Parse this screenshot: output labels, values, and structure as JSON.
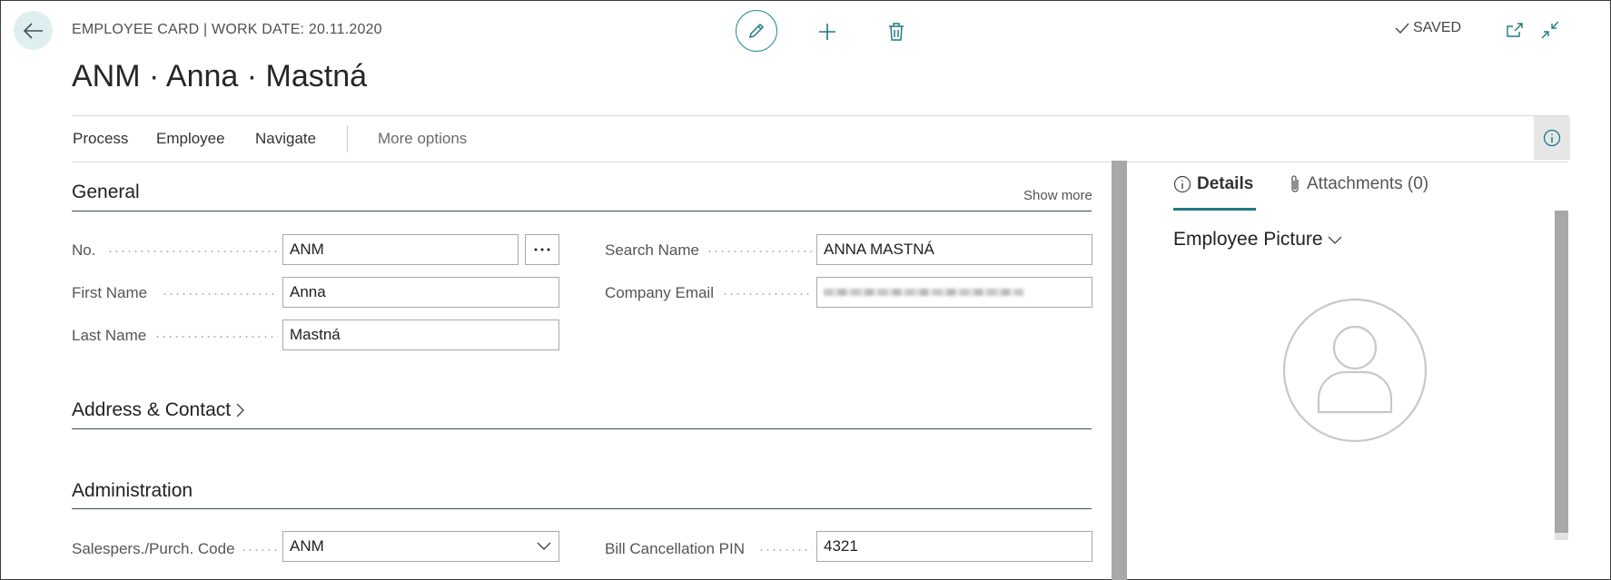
{
  "header": {
    "caption": "EMPLOYEE CARD | WORK DATE: 20.11.2020",
    "title": "ANM · Anna · Mastná",
    "saved_label": "SAVED"
  },
  "actions": [
    {
      "label": "Process"
    },
    {
      "label": "Employee"
    },
    {
      "label": "Navigate"
    },
    {
      "label": "More options"
    }
  ],
  "general": {
    "title": "General",
    "show_more": "Show more",
    "fields": {
      "no": {
        "label": "No.",
        "value": "ANM"
      },
      "first_name": {
        "label": "First Name",
        "value": "Anna"
      },
      "last_name": {
        "label": "Last Name",
        "value": "Mastná"
      },
      "search_name": {
        "label": "Search Name",
        "value": "ANNA MASTNÁ"
      },
      "company_email": {
        "label": "Company Email",
        "value": ""
      }
    }
  },
  "address_contact": {
    "title": "Address & Contact"
  },
  "administration": {
    "title": "Administration",
    "fields": {
      "salesperson": {
        "label": "Salespers./Purch. Code",
        "value": "ANM"
      },
      "bill_pin": {
        "label": "Bill Cancellation PIN",
        "value": "4321"
      }
    }
  },
  "factbox": {
    "tabs": [
      {
        "label": "Details",
        "icon": "info-icon"
      },
      {
        "label": "Attachments (0)",
        "icon": "paperclip-icon"
      }
    ],
    "employee_picture_title": "Employee Picture"
  },
  "colors": {
    "accent": "#1f7a84",
    "back_button_bg": "#dfeff0",
    "scrollbar": "#a8a8a8"
  }
}
